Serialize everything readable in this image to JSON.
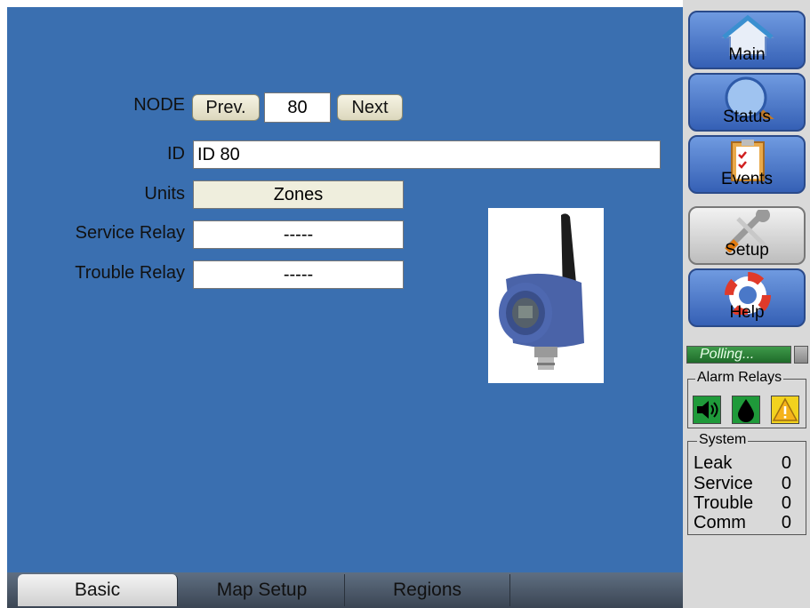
{
  "form": {
    "node_label": "NODE",
    "prev_label": "Prev.",
    "node_value": "80",
    "next_label": "Next",
    "id_label": "ID",
    "id_value": "ID 80",
    "units_label": "Units",
    "units_value": "Zones",
    "service_relay_label": "Service Relay",
    "service_relay_value": "-----",
    "trouble_relay_label": "Trouble Relay",
    "trouble_relay_value": "-----"
  },
  "tabs": [
    {
      "label": "Basic"
    },
    {
      "label": "Map Setup"
    },
    {
      "label": "Regions"
    }
  ],
  "nav": [
    {
      "label": "Main",
      "icon": "home-icon"
    },
    {
      "label": "Status",
      "icon": "magnifier-icon"
    },
    {
      "label": "Events",
      "icon": "clipboard-icon"
    },
    {
      "label": "Setup",
      "icon": "tools-icon"
    },
    {
      "label": "Help",
      "icon": "lifebuoy-icon"
    }
  ],
  "polling": {
    "text": "Polling..."
  },
  "alarm_relays": {
    "title": "Alarm Relays",
    "icons": [
      "speaker-icon",
      "drop-icon",
      "warning-icon"
    ]
  },
  "system": {
    "title": "System",
    "rows": [
      {
        "label": "Leak",
        "value": "0"
      },
      {
        "label": "Service",
        "value": "0"
      },
      {
        "label": "Trouble",
        "value": "0"
      },
      {
        "label": "Comm",
        "value": "0"
      }
    ]
  },
  "colors": {
    "background": "#3a6fb0",
    "nav_blue": "#4a78c8",
    "polling_green": "#2f8a3c",
    "relay_green": "#1f9a3a",
    "warning_yellow": "#f2d21e"
  }
}
